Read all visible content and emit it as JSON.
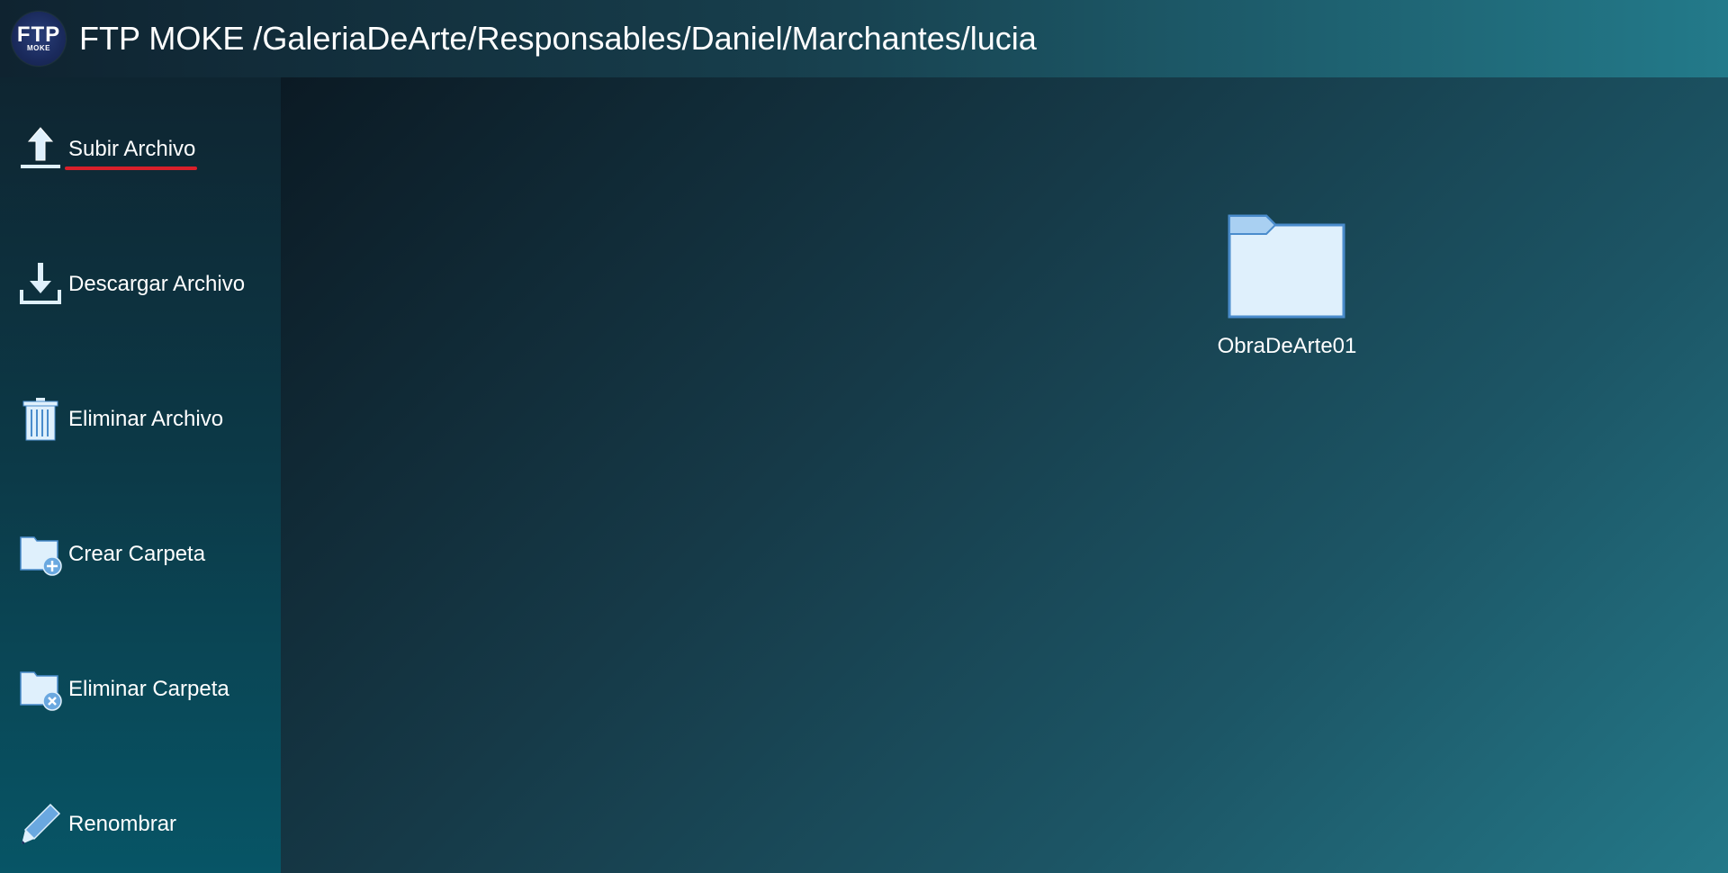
{
  "app": {
    "logo_text": "FTP",
    "logo_subtext": "MOKE",
    "title": "FTP MOKE /GaleriaDeArte/Responsables/Daniel/Marchantes/lucia"
  },
  "sidebar": {
    "items": [
      {
        "label": "Subir Archivo",
        "icon": "upload-icon",
        "active": true
      },
      {
        "label": "Descargar Archivo",
        "icon": "download-icon",
        "active": false
      },
      {
        "label": "Eliminar Archivo",
        "icon": "trash-icon",
        "active": false
      },
      {
        "label": "Crear Carpeta",
        "icon": "folder-add-icon",
        "active": false
      },
      {
        "label": "Eliminar Carpeta",
        "icon": "folder-delete-icon",
        "active": false
      },
      {
        "label": "Renombrar",
        "icon": "pencil-icon",
        "active": false
      }
    ]
  },
  "main": {
    "files": [
      {
        "name": "ObraDeArte01",
        "type": "folder",
        "icon": "folder-icon"
      }
    ]
  },
  "colors": {
    "accent_underline": "#d9202a",
    "icon_fill": "#dff0fc",
    "icon_stroke": "#4a8ccc"
  }
}
